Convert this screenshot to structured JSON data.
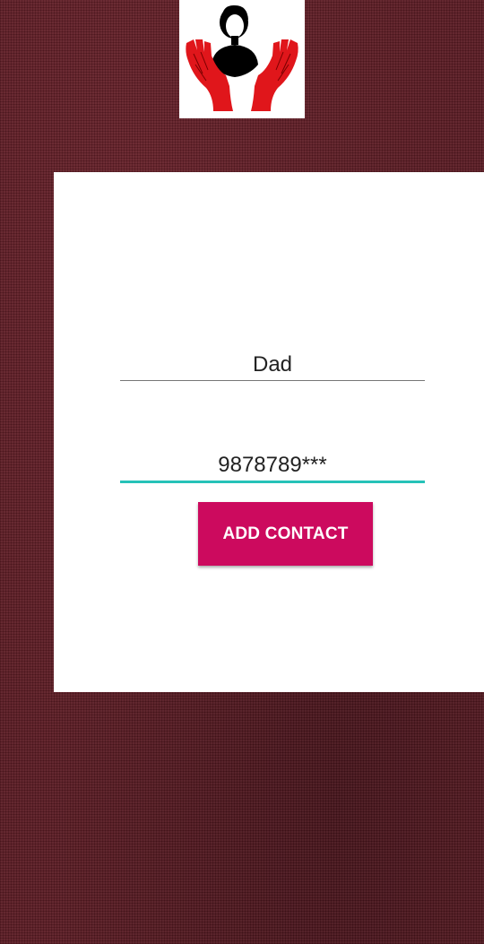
{
  "form": {
    "name_value": "Dad",
    "phone_value": "9878789***",
    "add_button_label": "ADD CONTACT"
  },
  "logo": {
    "icon": "woman-in-hands-logo",
    "hand_color": "#e0161b",
    "figure_color": "#000000"
  },
  "colors": {
    "background": "#5a1a22",
    "card": "#ffffff",
    "accent_button": "#cc0a5e",
    "focused_underline": "#26c2b8"
  }
}
